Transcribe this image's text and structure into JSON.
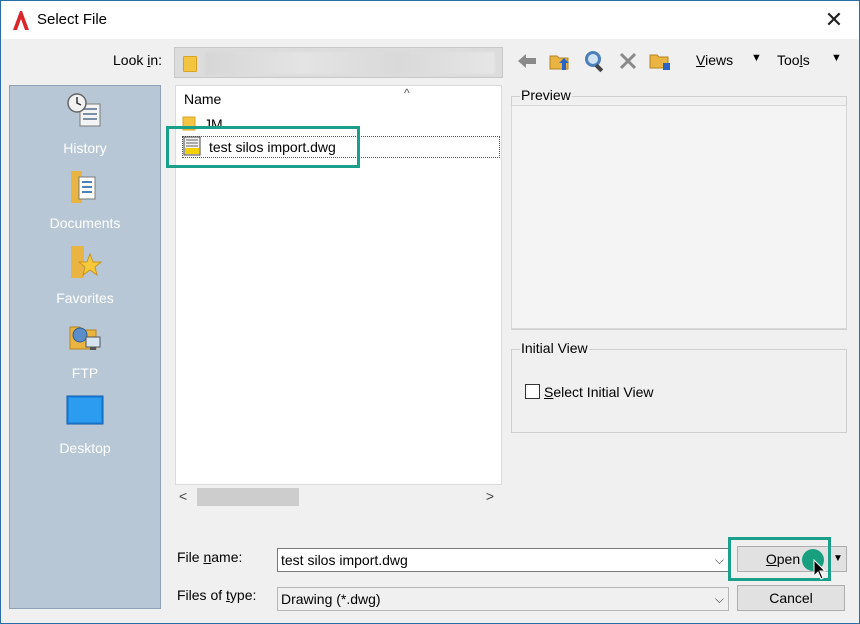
{
  "window": {
    "title": "Select File",
    "app_icon": "autocad-a-icon",
    "close_glyph": "✕"
  },
  "lookin": {
    "label_prefix": "Look ",
    "label_accel": "i",
    "label_suffix": "n:",
    "current": ""
  },
  "toolbar": {
    "views_label": "Views",
    "views_accel": "V",
    "views_rest": "iews",
    "tools_label": "Tools",
    "tools_pre": "Too",
    "tools_accel": "l",
    "tools_post": "s",
    "drop_glyph": "▼"
  },
  "places": [
    {
      "label": "History",
      "icon": "history-icon"
    },
    {
      "label": "Documents",
      "icon": "documents-icon"
    },
    {
      "label": "Favorites",
      "icon": "favorites-icon"
    },
    {
      "label": "FTP",
      "icon": "ftp-icon"
    },
    {
      "label": "Desktop",
      "icon": "desktop-icon"
    }
  ],
  "filelist": {
    "column_name": "Name",
    "sort_glyph": "^",
    "items": [
      {
        "name": "JM",
        "type": "folder"
      },
      {
        "name": "test silos import.dwg",
        "type": "dwg"
      }
    ]
  },
  "scroll": {
    "left": "<",
    "right": ">"
  },
  "preview": {
    "title": "Preview"
  },
  "initial_view": {
    "title": "Initial View",
    "checkbox_pre": "",
    "checkbox_accel": "S",
    "checkbox_post": "elect Initial View",
    "checked": false
  },
  "filename": {
    "label_pre": "File ",
    "label_accel": "n",
    "label_post": "ame:",
    "value": "test silos import.dwg"
  },
  "filetype": {
    "label_pre": "Files of ",
    "label_accel": "t",
    "label_post": "ype:",
    "value": "Drawing (*.dwg)"
  },
  "buttons": {
    "open_accel": "O",
    "open_rest": "pen",
    "cancel": "Cancel"
  },
  "colors": {
    "highlight": "#1aa08a",
    "sidebar": "#b7c7d6"
  }
}
